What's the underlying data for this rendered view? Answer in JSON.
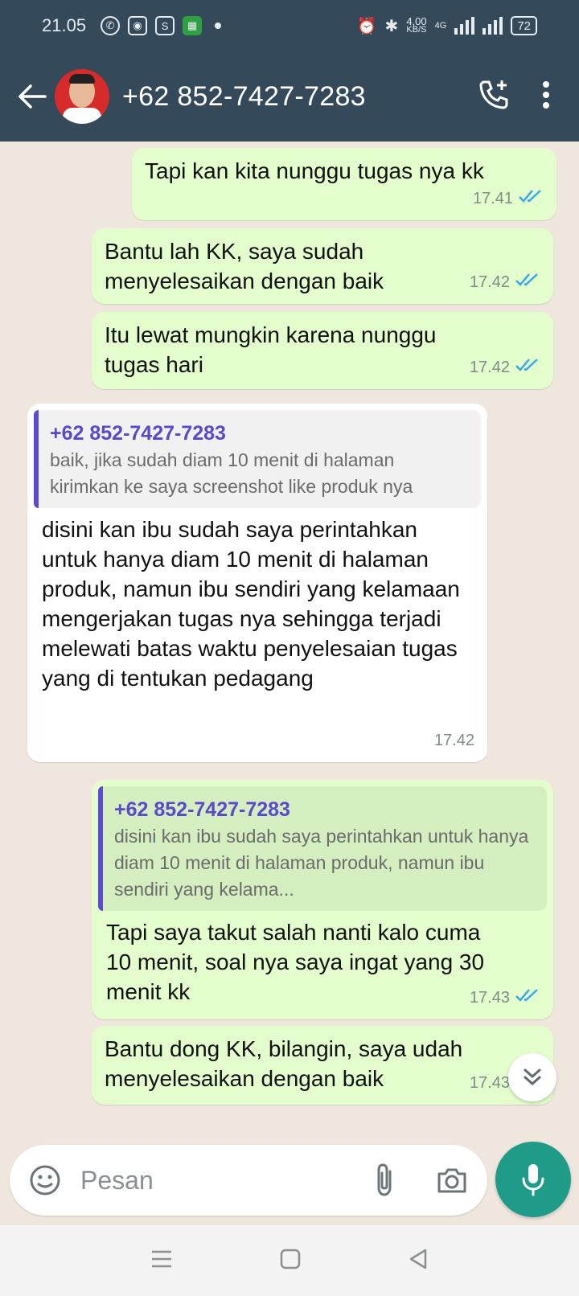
{
  "status_bar": {
    "time": "21.05",
    "speed_value": "4,00",
    "speed_unit": "KB/S",
    "network": "4G",
    "battery": "72"
  },
  "header": {
    "contact_name": "+62 852-7427-7283"
  },
  "messages": [
    {
      "text": "Tapi kan kita nunggu tugas nya kk",
      "time": "17.41"
    },
    {
      "text": "Bantu lah KK, saya sudah menyelesaikan dengan baik",
      "time": "17.42"
    },
    {
      "text": "Itu lewat mungkin karena nunggu tugas hari",
      "time": "17.42"
    },
    {
      "quote_name": "+62 852-7427-7283",
      "quote_text": "baik, jika sudah diam 10 menit di halaman kirimkan ke saya screenshot like produk nya",
      "text": "disini kan ibu sudah saya perintahkan untuk hanya diam 10 menit di halaman produk, namun ibu sendiri yang kelamaan mengerjakan tugas nya sehingga terjadi melewati batas waktu penyelesaian tugas yang di tentukan pedagang",
      "time": "17.42"
    },
    {
      "quote_name": "+62 852-7427-7283",
      "quote_text": "disini kan ibu sudah saya perintahkan untuk hanya diam 10 menit di halaman produk, namun ibu sendiri yang kelama...",
      "text": "Tapi saya takut salah nanti kalo cuma 10 menit, soal nya saya ingat yang 30 menit kk",
      "time": "17.43"
    },
    {
      "text": "Bantu dong KK, bilangin, saya udah menyelesaikan dengan baik",
      "time": "17.43"
    }
  ],
  "input": {
    "placeholder": "Pesan"
  },
  "colors": {
    "header": "#34495a",
    "outgoing": "#e3fdcd",
    "incoming": "#ffffff",
    "read_tick": "#3aa8e8",
    "mic": "#1e9c89"
  },
  "icons": [
    "back-arrow-icon",
    "add-call-icon",
    "more-vert-icon",
    "double-check-icon",
    "scroll-down-icon",
    "emoji-icon",
    "attach-icon",
    "camera-icon",
    "mic-icon",
    "nav-menu-icon",
    "nav-home-icon",
    "nav-back-icon"
  ]
}
